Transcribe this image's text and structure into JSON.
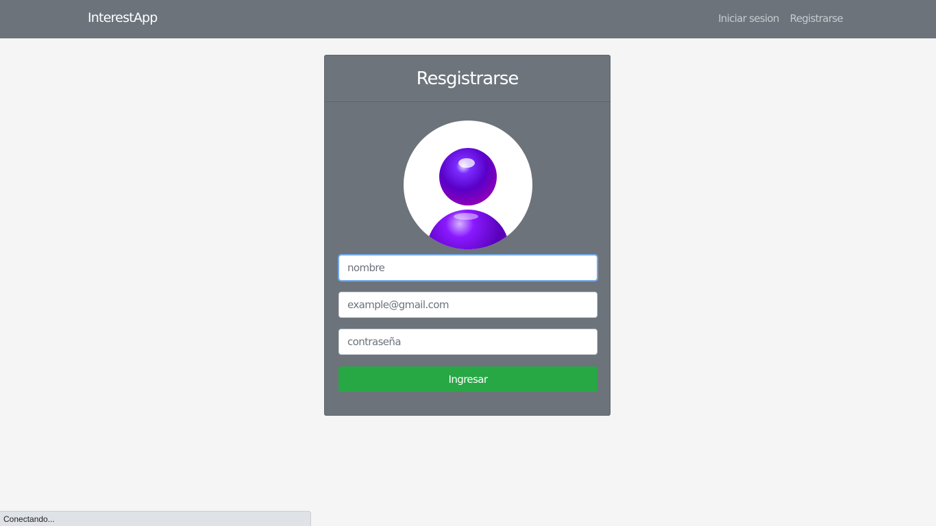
{
  "navbar": {
    "brand": "InterestApp",
    "links": [
      {
        "label": "Iniciar sesion"
      },
      {
        "label": "Registrarse"
      }
    ],
    "background": "#6c737b"
  },
  "card": {
    "title": "Resgistrarse",
    "avatar": {
      "icon": "user-avatar-icon",
      "colors": [
        "#7b00ff",
        "#b000d9"
      ]
    },
    "fields": {
      "name_placeholder": "nombre",
      "email_placeholder": "example@gmail.com",
      "password_placeholder": "contraseña"
    },
    "submit_label": "Ingresar",
    "submit_color": "#28a745"
  },
  "status": {
    "text": "Conectando..."
  }
}
